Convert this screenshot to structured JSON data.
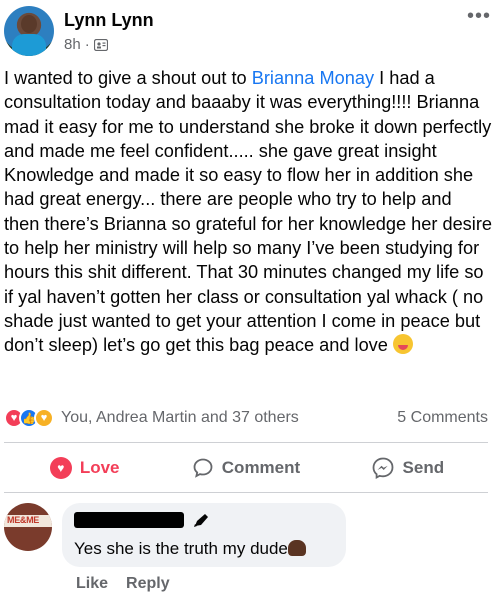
{
  "post": {
    "author": "Lynn Lynn",
    "time": "8h",
    "separator": "·",
    "text_before": "I wanted to give a shout out to ",
    "mention": "Brianna Monay",
    "text_after": " I had a consultation today and baaaby it was everything!!!! Brianna mad it easy for me to understand she broke it down perfectly and made me feel confident..... she gave great insight Knowledge and made it so easy to flow her in addition she had great energy... there are people who try to help and then there’s Brianna so grateful for her knowledge her desire to help her ministry will help so many I’ve been studying for hours this shit different. That 30 minutes changed my life so if yal haven’t gotten her class or consultation yal whack ( no shade just wanted to get your attention I come in peace but don’t sleep) let’s go get this bag peace and love ",
    "emoji": "winking-tongue-emoji"
  },
  "reactions": {
    "icons": [
      "love",
      "like",
      "care"
    ],
    "summary": "You, Andrea Martin and 37 others",
    "comments": "5 Comments"
  },
  "actions": {
    "love": "Love",
    "comment": "Comment",
    "send": "Send"
  },
  "comment": {
    "author": "",
    "text": "Yes she is the truth my dude",
    "like": "Like",
    "reply": "Reply"
  },
  "colors": {
    "mention": "#1877f2",
    "love": "#f33e58",
    "muted": "#65676b"
  }
}
